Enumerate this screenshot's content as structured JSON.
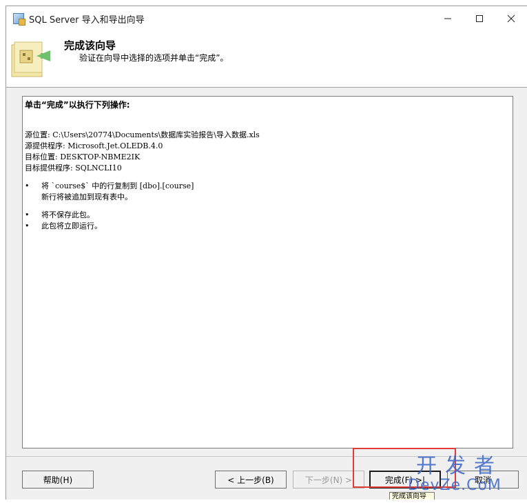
{
  "window": {
    "title": "SQL Server 导入和导出向导"
  },
  "header": {
    "title": "完成该向导",
    "subtitle": "验证在向导中选择的选项并单击“完成”。"
  },
  "summary": {
    "heading": "单击“完成”以执行下列操作:",
    "source_location": "源位置: C:\\Users\\20774\\Documents\\数据库实验报告\\导入数据.xls",
    "source_provider": "源提供程序: Microsoft.Jet.OLEDB.4.0",
    "target_location": "目标位置: DESKTOP-NBME2IK",
    "target_provider": "目标提供程序: SQLNCLI10",
    "bullets": [
      {
        "line1": "将 `course$` 中的行复制到 [dbo].[course]",
        "line2": "新行将被追加到现有表中。"
      },
      {
        "line1": "将不保存此包。"
      },
      {
        "line1": "此包将立即运行。"
      }
    ]
  },
  "buttons": {
    "help": "帮助(H)",
    "back": "< 上一步(B)",
    "next": "下一步(N) >",
    "finish": "完成(F) >|",
    "cancel": "取消"
  },
  "tooltip": "完成该向导",
  "watermark": {
    "top": "开发者",
    "bottom": "DevZe.CoM"
  },
  "colors": {
    "highlight": "#e03a3a",
    "watermark": "#3a66c8"
  }
}
